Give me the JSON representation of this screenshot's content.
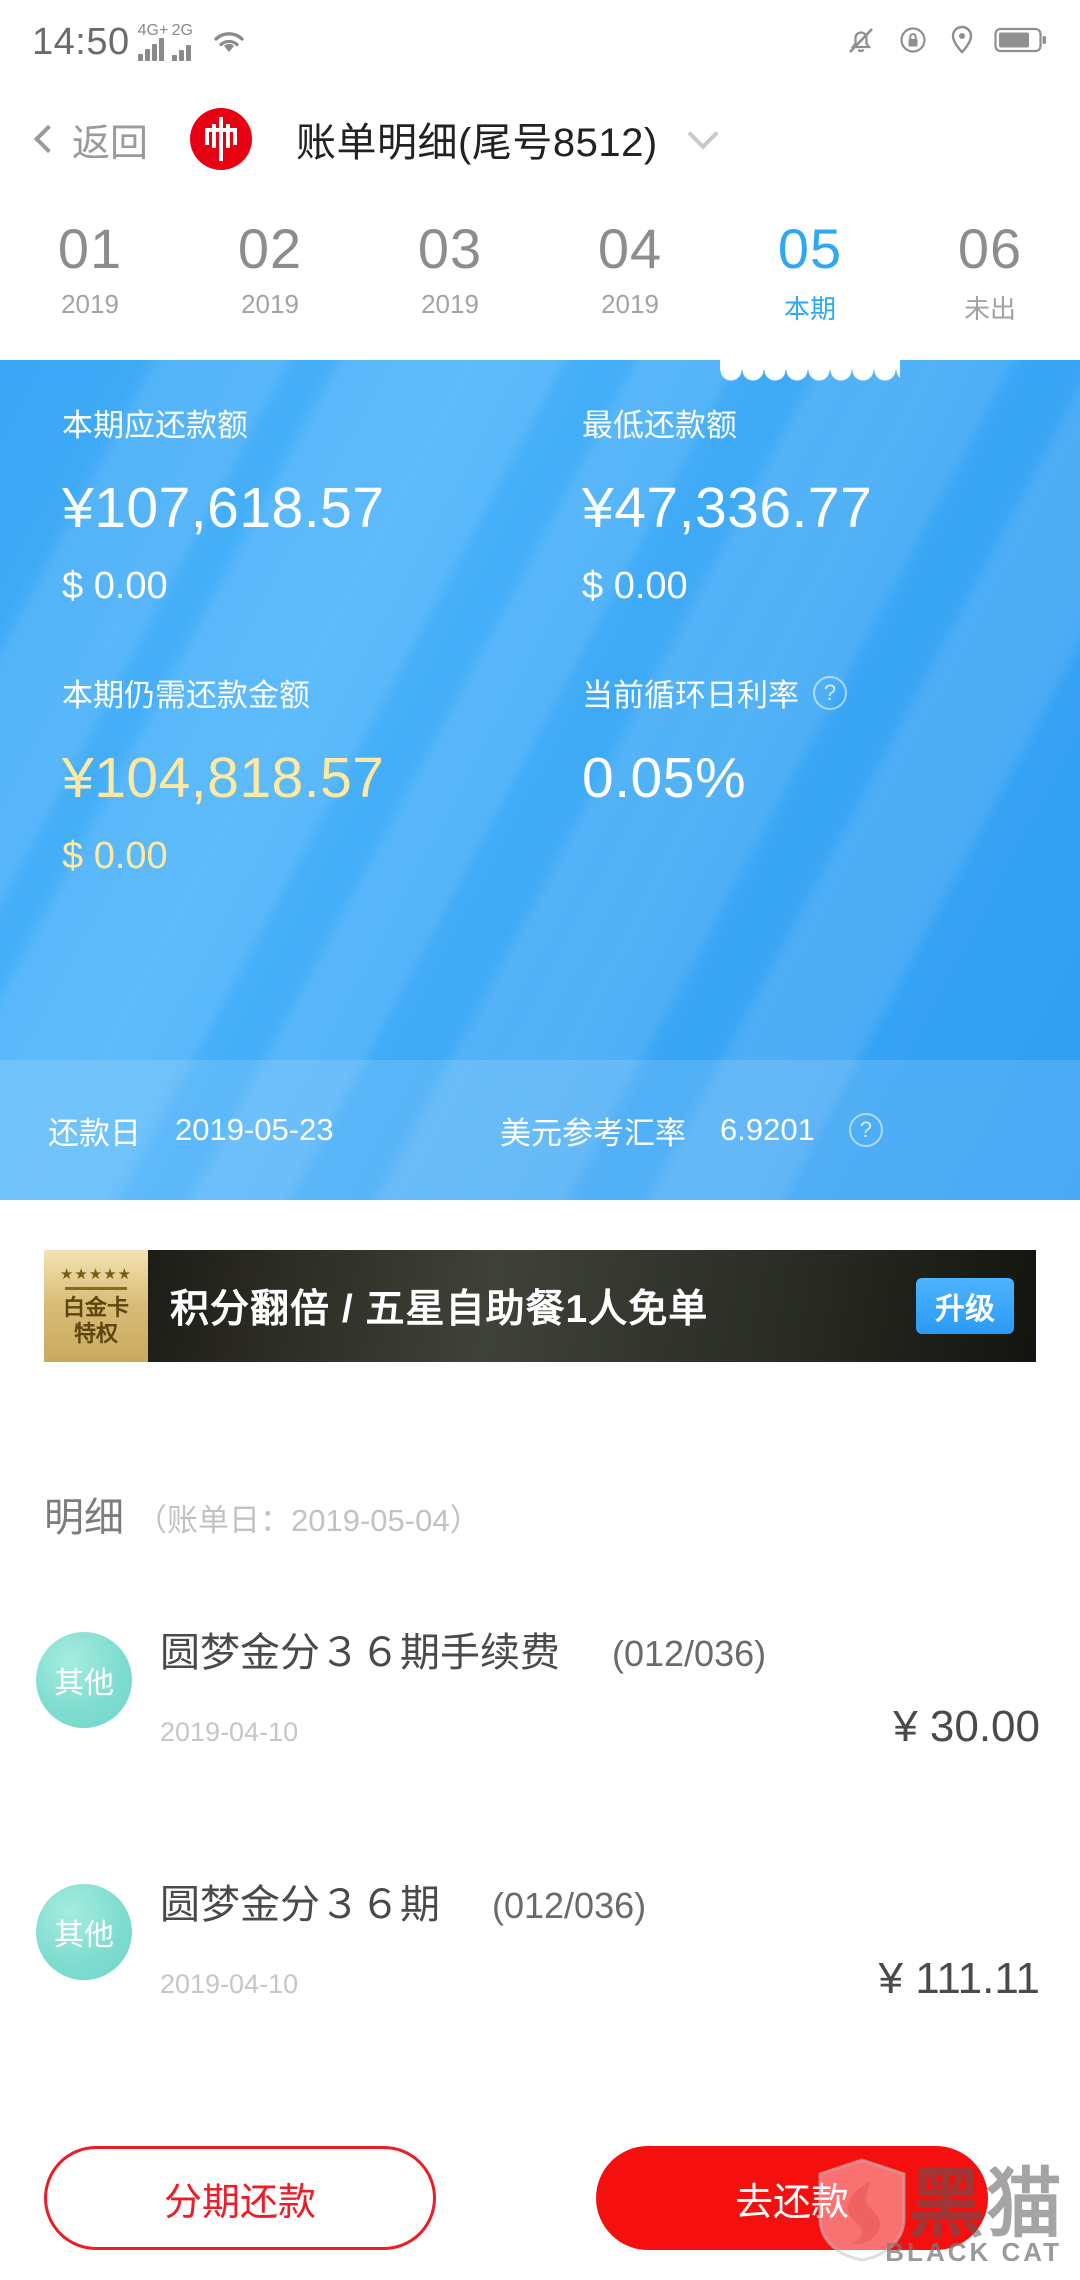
{
  "status_bar": {
    "time": "14:50",
    "net_primary": "4G+",
    "net_secondary": "2G",
    "icons": [
      "wifi-icon",
      "bell-muted-icon",
      "rotation-lock-icon",
      "location-icon",
      "battery-icon"
    ]
  },
  "nav": {
    "back_label": "返回",
    "bank_logo_glyph": "中",
    "title": "账单明细(尾号8512)",
    "dropdown_icon": "chevron-down-icon"
  },
  "tabs": [
    {
      "month": "01",
      "sub": "2019",
      "active": false
    },
    {
      "month": "02",
      "sub": "2019",
      "active": false
    },
    {
      "month": "03",
      "sub": "2019",
      "active": false
    },
    {
      "month": "04",
      "sub": "2019",
      "active": false
    },
    {
      "month": "05",
      "sub": "本期",
      "active": true
    },
    {
      "month": "06",
      "sub": "未出",
      "active": false
    }
  ],
  "bill_card": {
    "accent_color": "#3da9f6",
    "highlight_color": "#ffe9a0",
    "due_amount": {
      "label": "本期应还款额",
      "cny": "¥107,618.57",
      "usd": "$ 0.00"
    },
    "min_amount": {
      "label": "最低还款额",
      "cny": "¥47,336.77",
      "usd": "$ 0.00"
    },
    "remaining": {
      "label": "本期仍需还款金额",
      "cny": "¥104,818.57",
      "usd": "$ 0.00"
    },
    "daily_rate": {
      "label": "当前循环日利率",
      "value": "0.05%",
      "help_icon": "question-mark-icon"
    },
    "footer": {
      "repay_date_label": "还款日",
      "repay_date_value": "2019-05-23",
      "fx_label": "美元参考汇率",
      "fx_value": "6.9201",
      "help_icon": "question-mark-icon"
    }
  },
  "promo": {
    "badge_stars": "★★★★★",
    "badge_line1": "白金卡",
    "badge_line2": "特权",
    "text": "积分翻倍 / 五星自助餐1人免单",
    "button_label": "升级",
    "button_color": "#2b9af6"
  },
  "detail": {
    "title": "明细",
    "subtitle": "（账单日：2019-05-04）",
    "transactions": [
      {
        "category": "其他",
        "name": "圆梦金分３６期手续费",
        "term": "(012/036)",
        "date": "2019-04-10",
        "amount": "¥ 30.00"
      },
      {
        "category": "其他",
        "name": "圆梦金分３６期",
        "term": "(012/036)",
        "date": "2019-04-10",
        "amount": "¥ 111.11"
      }
    ]
  },
  "actions": {
    "installment_label": "分期还款",
    "repay_label": "去还款",
    "primary_color": "#f50f0f",
    "outline_color": "#ee1c25"
  },
  "watermark": {
    "cn": "黑猫",
    "en": "BLACK CAT"
  }
}
